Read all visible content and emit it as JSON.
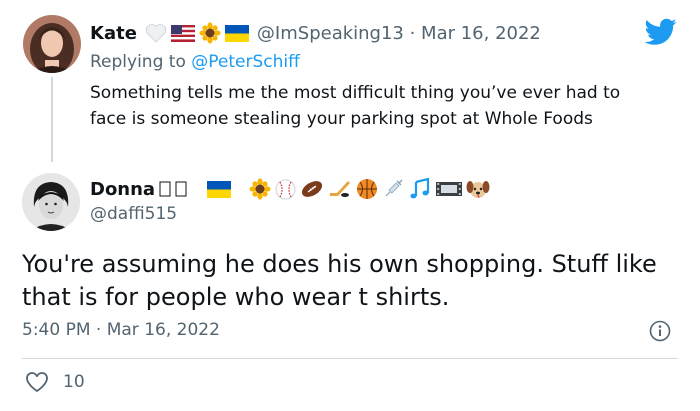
{
  "reply": {
    "name": "Kate",
    "handle_date": "@ImSpeaking13 · Mar 16, 2022",
    "replying_prefix": "Replying to",
    "replying_to": "@PeterSchiff",
    "text": "Something tells me the most difficult thing you’ve ever had to face is someone stealing your parking spot at Whole Foods",
    "name_emojis": [
      "white-heart",
      "us-flag",
      "sunflower",
      "ukraine-flag"
    ]
  },
  "tweet": {
    "name": "Donna",
    "handle": "@daffi515",
    "name_emojis": [
      "ukraine-flag",
      "sunflower",
      "baseball",
      "football",
      "hockey",
      "basketball",
      "syringe",
      "music-notes",
      "film",
      "dog-face"
    ],
    "text": "You're assuming he does his own shopping. Stuff like that is for people who wear t shirts.",
    "timestamp": "5:40 PM · Mar 16, 2022",
    "like_count": "10"
  },
  "icons": {
    "logo": "twitter-bird-icon",
    "info": "info-icon",
    "like": "heart-icon"
  },
  "colors": {
    "twitter_blue": "#1d9bf0",
    "text": "#0f1419",
    "secondary": "#536471",
    "divider": "#cfd9de"
  }
}
